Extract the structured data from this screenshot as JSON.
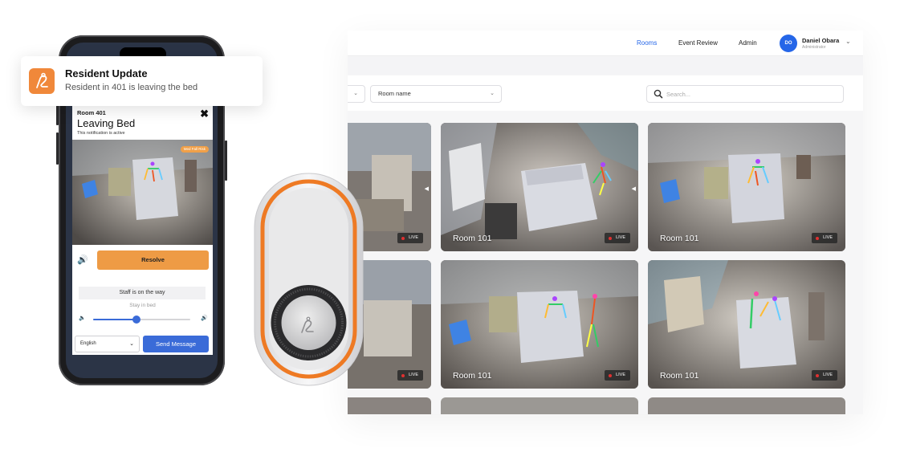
{
  "dashboard": {
    "nav": [
      {
        "label": "Rooms",
        "active": true
      },
      {
        "label": "Event Review",
        "active": false
      },
      {
        "label": "Admin",
        "active": false
      }
    ],
    "user": {
      "initials": "DO",
      "name": "Daniel Obara",
      "role": "Administrator"
    },
    "filters": {
      "room_name_label": "Room name"
    },
    "search": {
      "placeholder": "Search..."
    },
    "cameras": [
      {
        "room": "",
        "live": "LIVE"
      },
      {
        "room": "Room 101",
        "live": "LIVE"
      },
      {
        "room": "Room 101",
        "live": "LIVE"
      },
      {
        "room": "",
        "live": "LIVE"
      },
      {
        "room": "Room 101",
        "live": "LIVE"
      },
      {
        "room": "Room 101",
        "live": "LIVE"
      }
    ]
  },
  "notification": {
    "title": "Resident Update",
    "body": "Resident in 401 is leaving the bed"
  },
  "phone_app": {
    "room": "Room 401",
    "alert_title": "Leaving Bed",
    "status_note": "This notification is active",
    "risk_badge": "Med Fall Risk",
    "resolve_label": "Resolve",
    "staff_message": "Staff is on the way",
    "stay_message": "Stay in bed",
    "volume_level": 0.45,
    "language": "English",
    "send_label": "Send Message"
  },
  "colors": {
    "accent_blue": "#2566e8",
    "accent_orange": "#ee9b45",
    "live_dot": "#e03030"
  }
}
